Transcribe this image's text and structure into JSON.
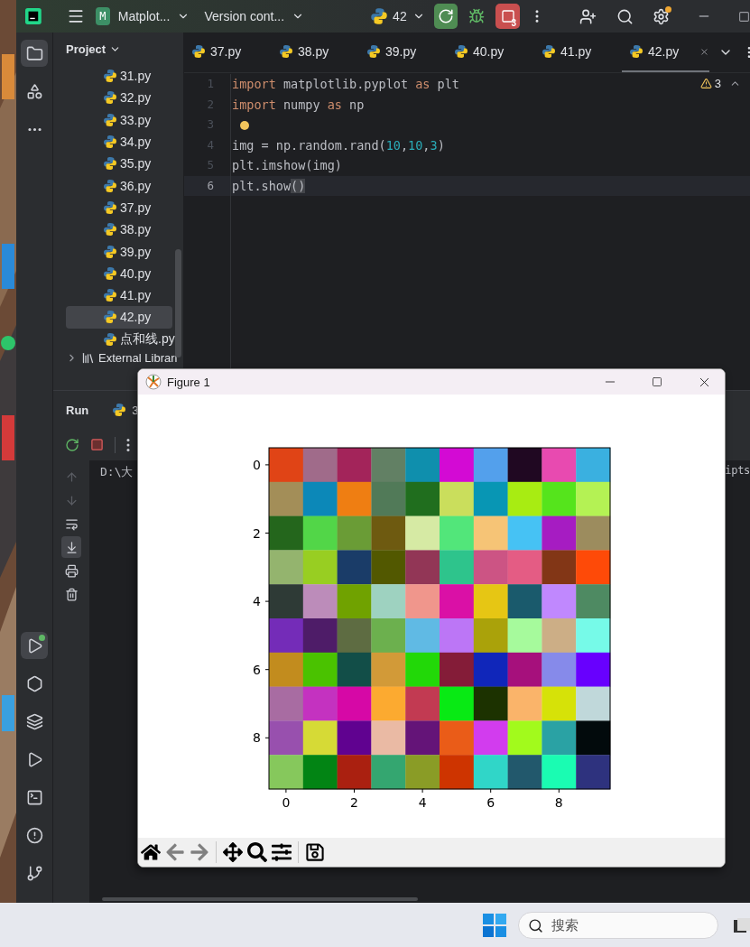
{
  "top_bar": {
    "project_badge": "M",
    "project": "Matplot...",
    "vcs": "Version cont...",
    "run_config": "42",
    "stop_count": "3"
  },
  "project_panel": {
    "title": "Project",
    "files": [
      {
        "name": "31.py",
        "selected": false
      },
      {
        "name": "32.py",
        "selected": false
      },
      {
        "name": "33.py",
        "selected": false
      },
      {
        "name": "34.py",
        "selected": false
      },
      {
        "name": "35.py",
        "selected": false
      },
      {
        "name": "36.py",
        "selected": false
      },
      {
        "name": "37.py",
        "selected": false
      },
      {
        "name": "38.py",
        "selected": false
      },
      {
        "name": "39.py",
        "selected": false
      },
      {
        "name": "40.py",
        "selected": false
      },
      {
        "name": "41.py",
        "selected": false
      },
      {
        "name": "42.py",
        "selected": true
      },
      {
        "name": "点和线.py",
        "selected": false
      }
    ],
    "nodes": [
      {
        "kind": "libraries",
        "label": "External Librari"
      }
    ]
  },
  "editor_tabs": [
    {
      "label": "37.py",
      "selected": false
    },
    {
      "label": "38.py",
      "selected": false
    },
    {
      "label": "39.py",
      "selected": false
    },
    {
      "label": "40.py",
      "selected": false
    },
    {
      "label": "41.py",
      "selected": false
    },
    {
      "label": "42.py",
      "selected": true
    }
  ],
  "editor": {
    "warnings": "3",
    "lines": [
      {
        "number": "1",
        "current": false,
        "tokens": [
          {
            "kind": "keyword",
            "text": "import"
          },
          {
            "kind": "plain",
            "text": " matplotlib.pyplot "
          },
          {
            "kind": "keyword",
            "text": "as"
          },
          {
            "kind": "plain",
            "text": " plt"
          }
        ]
      },
      {
        "number": "2",
        "current": false,
        "tokens": [
          {
            "kind": "keyword",
            "text": "import"
          },
          {
            "kind": "plain",
            "text": " numpy "
          },
          {
            "kind": "keyword",
            "text": "as"
          },
          {
            "kind": "plain",
            "text": " np"
          }
        ]
      },
      {
        "number": "3",
        "current": false
      },
      {
        "number": "4",
        "current": false,
        "tokens": [
          {
            "kind": "plain",
            "text": "img = np.random.rand("
          },
          {
            "kind": "number",
            "text": "10"
          },
          {
            "kind": "plain",
            "text": ","
          },
          {
            "kind": "number",
            "text": "10"
          },
          {
            "kind": "plain",
            "text": ","
          },
          {
            "kind": "number",
            "text": "3"
          },
          {
            "kind": "plain",
            "text": ")"
          }
        ]
      },
      {
        "number": "5",
        "current": false,
        "tokens": [
          {
            "kind": "plain",
            "text": "plt.imshow(img)"
          }
        ]
      },
      {
        "number": "6",
        "current": true,
        "tokens": [
          {
            "kind": "plain",
            "text": "plt.show"
          },
          {
            "kind": "bracket",
            "text": "()"
          }
        ]
      }
    ]
  },
  "run_panel": {
    "title": "Run",
    "tab": "3",
    "console": [
      "D:\\大",
      "ipts"
    ],
    "side_tools": [
      {
        "kind": "up",
        "disabled": true,
        "on": false
      },
      {
        "kind": "down",
        "disabled": true,
        "on": false
      },
      {
        "kind": "wrap",
        "disabled": false,
        "on": false
      },
      {
        "kind": "scroll_end",
        "disabled": false,
        "on": true
      },
      {
        "kind": "print",
        "disabled": false,
        "on": false
      },
      {
        "kind": "trash",
        "disabled": false,
        "on": false
      }
    ]
  },
  "figure": {
    "title": "Figure 1",
    "xticks": [
      "0",
      "2",
      "4",
      "6",
      "8"
    ],
    "yticks": [
      "0",
      "2",
      "4",
      "6",
      "8"
    ],
    "toolbar": [
      {
        "kind": "home",
        "disabled": false
      },
      {
        "kind": "back",
        "disabled": true
      },
      {
        "kind": "forward",
        "disabled": true
      },
      {
        "kind": "separator"
      },
      {
        "kind": "pan",
        "disabled": false
      },
      {
        "kind": "zoom",
        "disabled": false
      },
      {
        "kind": "configure",
        "disabled": false
      },
      {
        "kind": "separator"
      },
      {
        "kind": "save",
        "disabled": false
      }
    ]
  },
  "taskbar": {
    "search_placeholder": "搜索"
  }
}
